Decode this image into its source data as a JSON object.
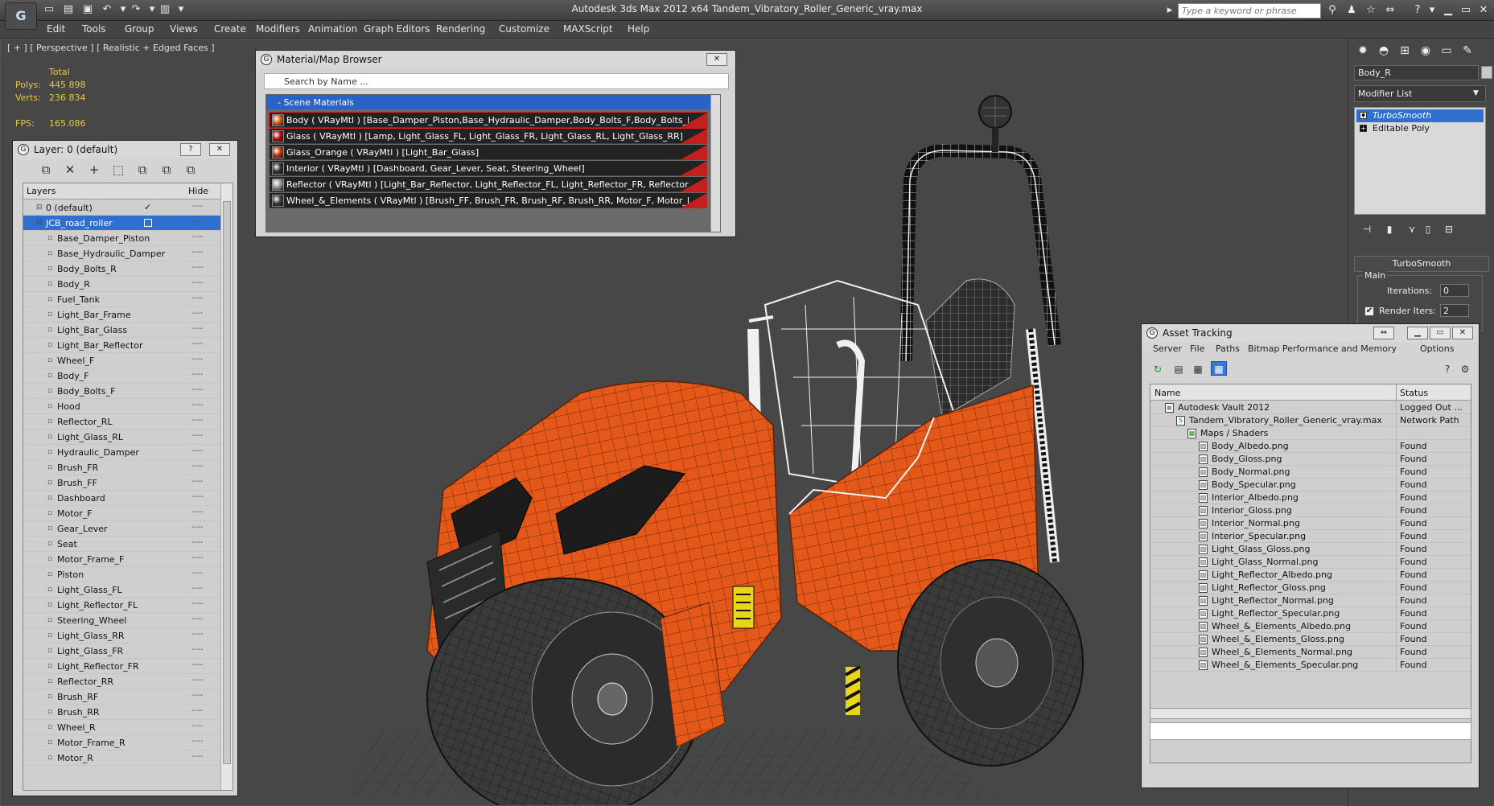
{
  "app": {
    "title": "Autodesk 3ds Max  2012 x64      Tandem_Vibratory_Roller_Generic_vray.max",
    "search_placeholder": "Type a keyword or phrase",
    "menu": [
      "Edit",
      "Tools",
      "Group",
      "Views",
      "Create",
      "Modifiers",
      "Animation",
      "Graph Editors",
      "Rendering",
      "Customize",
      "MAXScript",
      "Help"
    ]
  },
  "viewport": {
    "label": "[ + ] [ Perspective ] [ Realistic + Edged Faces ]",
    "stats": {
      "total_label": "Total",
      "polys_label": "Polys:",
      "polys_value": "445 898",
      "verts_label": "Verts:",
      "verts_value": "236 834",
      "fps_label": "FPS:",
      "fps_value": "165.086"
    }
  },
  "layer_window": {
    "title": "Layer: 0 (default)",
    "help_label": "?",
    "close_label": "✕",
    "col_layers": "Layers",
    "col_hide": "Hide",
    "rows": [
      {
        "name": "0 (default)",
        "level": 0,
        "checked": true
      },
      {
        "name": "JCB_road_roller",
        "level": 0,
        "selected": true
      },
      {
        "name": "Base_Damper_Piston",
        "level": 1
      },
      {
        "name": "Base_Hydraulic_Damper",
        "level": 1
      },
      {
        "name": "Body_Bolts_R",
        "level": 1
      },
      {
        "name": "Body_R",
        "level": 1
      },
      {
        "name": "Fuel_Tank",
        "level": 1
      },
      {
        "name": "Light_Bar_Frame",
        "level": 1
      },
      {
        "name": "Light_Bar_Glass",
        "level": 1
      },
      {
        "name": "Light_Bar_Reflector",
        "level": 1
      },
      {
        "name": "Wheel_F",
        "level": 1
      },
      {
        "name": "Body_F",
        "level": 1
      },
      {
        "name": "Body_Bolts_F",
        "level": 1
      },
      {
        "name": "Hood",
        "level": 1
      },
      {
        "name": "Reflector_RL",
        "level": 1
      },
      {
        "name": "Light_Glass_RL",
        "level": 1
      },
      {
        "name": "Hydraulic_Damper",
        "level": 1
      },
      {
        "name": "Brush_FR",
        "level": 1
      },
      {
        "name": "Brush_FF",
        "level": 1
      },
      {
        "name": "Dashboard",
        "level": 1
      },
      {
        "name": "Motor_F",
        "level": 1
      },
      {
        "name": "Gear_Lever",
        "level": 1
      },
      {
        "name": "Seat",
        "level": 1
      },
      {
        "name": "Motor_Frame_F",
        "level": 1
      },
      {
        "name": "Piston",
        "level": 1
      },
      {
        "name": "Light_Glass_FL",
        "level": 1
      },
      {
        "name": "Light_Reflector_FL",
        "level": 1
      },
      {
        "name": "Steering_Wheel",
        "level": 1
      },
      {
        "name": "Light_Glass_RR",
        "level": 1
      },
      {
        "name": "Light_Glass_FR",
        "level": 1
      },
      {
        "name": "Light_Reflector_FR",
        "level": 1
      },
      {
        "name": "Reflector_RR",
        "level": 1
      },
      {
        "name": "Brush_RF",
        "level": 1
      },
      {
        "name": "Brush_RR",
        "level": 1
      },
      {
        "name": "Wheel_R",
        "level": 1
      },
      {
        "name": "Motor_Frame_R",
        "level": 1
      },
      {
        "name": "Motor_R",
        "level": 1
      }
    ]
  },
  "material_browser": {
    "title": "Material/Map Browser",
    "close_label": "✕",
    "search_placeholder": "Search by Name ...",
    "group_label": "- Scene Materials",
    "items": [
      {
        "text": "Body  ( VRayMtl ) [Base_Damper_Piston,Base_Hydraulic_Damper,Body_Bolts_F,Body_Bolts_R,Body_F,Body_R,Fuel_Tank",
        "swatch": "#d95a1e"
      },
      {
        "text": "Glass  ( VRayMtl ) [Lamp, Light_Glass_FL, Light_Glass_FR, Light_Glass_RL, Light_Glass_RR]",
        "swatch": "#b01010"
      },
      {
        "text": "Glass_Orange  ( VRayMtl ) [Light_Bar_Glass]",
        "swatch": "#c23512"
      },
      {
        "text": "Interior  ( VRayMtl ) [Dashboard, Gear_Lever, Seat, Steering_Wheel]",
        "swatch": "#333333"
      },
      {
        "text": "Reflector  ( VRayMtl ) [Light_Bar_Reflector, Light_Reflector_FL, Light_Reflector_FR, Reflector_RL, Reflector_RR]",
        "swatch": "#9a9a9a"
      },
      {
        "text": "Wheel_&_Elements  ( VRayMtl ) [Brush_FF, Brush_FR, Brush_RF, Brush_RR, Motor_F, Motor_Frame_F, Motor_Frame_R]",
        "swatch": "#3a3a3a"
      }
    ]
  },
  "command_panel": {
    "object_name": "Body_R",
    "modifier_list": "Modifier List",
    "stack": [
      {
        "name": "TurboSmooth",
        "selected": true
      },
      {
        "name": "Editable Poly",
        "selected": false
      }
    ],
    "turbosmooth_rollout": "TurboSmooth",
    "main_group": "Main",
    "iterations_label": "Iterations:",
    "iterations_value": "0",
    "render_iters_label": "Render Iters:",
    "render_iters_value": "2",
    "render_iters_checked": "✔"
  },
  "asset_tracking": {
    "title": "Asset Tracking",
    "menu": [
      "Server",
      "File",
      "Paths",
      "Bitmap Performance and Memory",
      "Options"
    ],
    "col_name": "Name",
    "col_status": "Status",
    "rows": [
      {
        "name": "Autodesk Vault 2012",
        "status": "Logged Out ...",
        "level": 0,
        "icon": "vault"
      },
      {
        "name": "Tandem_Vibratory_Roller_Generic_vray.max",
        "status": "Network Path",
        "level": 1,
        "icon": "max"
      },
      {
        "name": "Maps / Shaders",
        "status": "",
        "level": 2,
        "icon": "folder"
      },
      {
        "name": "Body_Albedo.png",
        "status": "Found",
        "level": 3,
        "icon": "bitmap"
      },
      {
        "name": "Body_Gloss.png",
        "status": "Found",
        "level": 3,
        "icon": "bitmap"
      },
      {
        "name": "Body_Normal.png",
        "status": "Found",
        "level": 3,
        "icon": "bitmap"
      },
      {
        "name": "Body_Specular.png",
        "status": "Found",
        "level": 3,
        "icon": "bitmap"
      },
      {
        "name": "Interior_Albedo.png",
        "status": "Found",
        "level": 3,
        "icon": "bitmap"
      },
      {
        "name": "Interior_Gloss.png",
        "status": "Found",
        "level": 3,
        "icon": "bitmap"
      },
      {
        "name": "Interior_Normal.png",
        "status": "Found",
        "level": 3,
        "icon": "bitmap"
      },
      {
        "name": "Interior_Specular.png",
        "status": "Found",
        "level": 3,
        "icon": "bitmap"
      },
      {
        "name": "Light_Glass_Gloss.png",
        "status": "Found",
        "level": 3,
        "icon": "bitmap"
      },
      {
        "name": "Light_Glass_Normal.png",
        "status": "Found",
        "level": 3,
        "icon": "bitmap"
      },
      {
        "name": "Light_Reflector_Albedo.png",
        "status": "Found",
        "level": 3,
        "icon": "bitmap"
      },
      {
        "name": "Light_Reflector_Gloss.png",
        "status": "Found",
        "level": 3,
        "icon": "bitmap"
      },
      {
        "name": "Light_Reflector_Normal.png",
        "status": "Found",
        "level": 3,
        "icon": "bitmap"
      },
      {
        "name": "Light_Reflector_Specular.png",
        "status": "Found",
        "level": 3,
        "icon": "bitmap"
      },
      {
        "name": "Wheel_&_Elements_Albedo.png",
        "status": "Found",
        "level": 3,
        "icon": "bitmap"
      },
      {
        "name": "Wheel_&_Elements_Gloss.png",
        "status": "Found",
        "level": 3,
        "icon": "bitmap"
      },
      {
        "name": "Wheel_&_Elements_Normal.png",
        "status": "Found",
        "level": 3,
        "icon": "bitmap"
      },
      {
        "name": "Wheel_&_Elements_Specular.png",
        "status": "Found",
        "level": 3,
        "icon": "bitmap"
      }
    ]
  },
  "colors": {
    "body_orange": "#e4581a",
    "selection_blue": "#2e6fd0",
    "viewport_bg": "#474747",
    "stat_yellow": "#e8c74a"
  }
}
